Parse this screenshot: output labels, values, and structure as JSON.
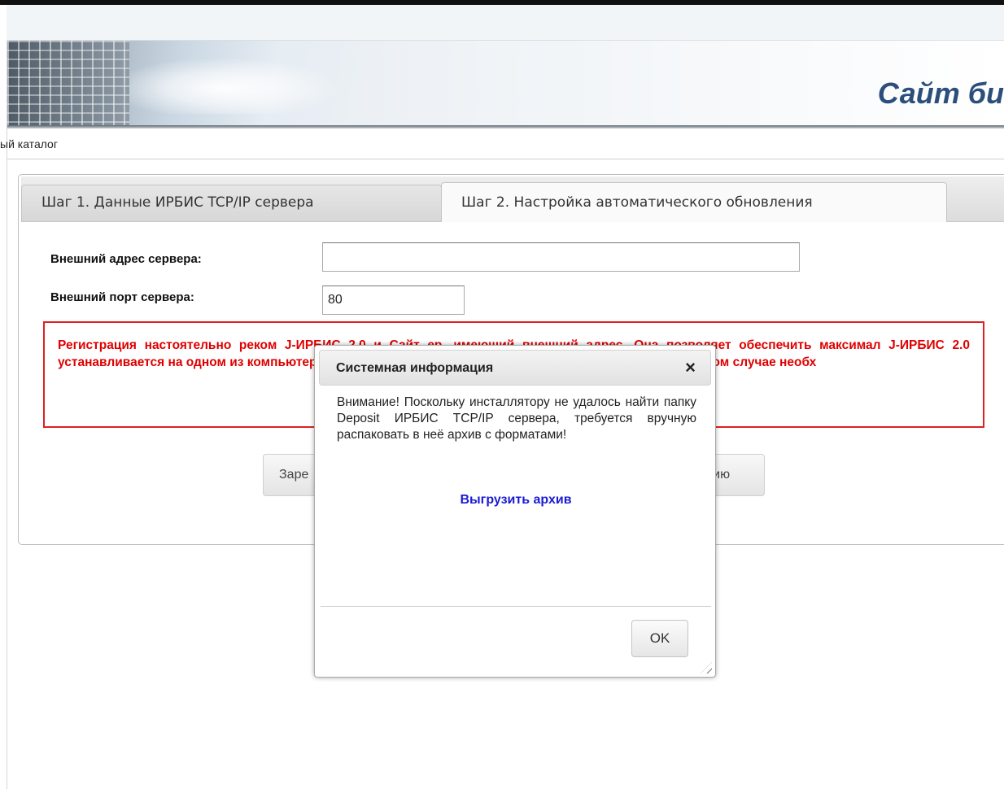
{
  "header": {
    "site_title": "Сайт би"
  },
  "breadcrumb": {
    "text": "ый каталог"
  },
  "tabs": [
    {
      "label": "Шаг 1. Данные ИРБИС TCP/IP сервера",
      "active": false
    },
    {
      "label": "Шаг 2. Настройка автоматического обновления",
      "active": true
    }
  ],
  "form": {
    "address_label": "Внешний адрес сервера:",
    "address_value": "",
    "port_label": "Внешний порт сервера:",
    "port_value": "80"
  },
  "warning": {
    "text": "Регистрация настоятельно реком                                      J-ИРБИС 2.0 и      Сайт      ер, имеющий внешний адрес. Она позволяет обеспечить максимал                                                     J-ИРБИС 2.0 устанавливается на одном из компьютеров локально                                                       для тестирования), обновление невозможно. В этом случае необх",
    "color": "#e00000"
  },
  "buttons": {
    "left_label": "Заре",
    "right_label": "цию"
  },
  "dialog": {
    "title": "Системная информация",
    "close_icon": "×",
    "message": "Внимание! Поскольку инсталлятору не удалось найти папку Deposit ИРБИС TCP/IP сервера, требуется вручную распаковать в неё архив с форматами!",
    "link_label": "Выгрузить архив",
    "ok_label": "OK"
  }
}
